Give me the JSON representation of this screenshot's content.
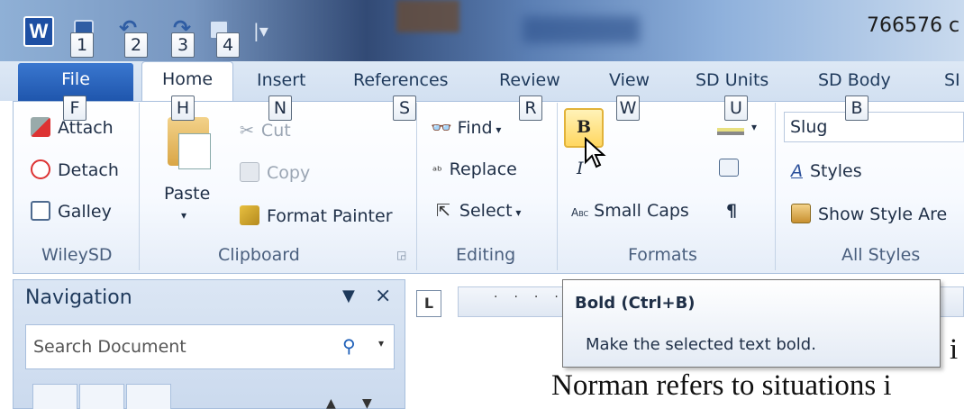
{
  "window": {
    "title": "766576 c"
  },
  "tabs": [
    {
      "label": "File"
    },
    {
      "label": "Home"
    },
    {
      "label": "Insert"
    },
    {
      "label": "References"
    },
    {
      "label": "Review"
    },
    {
      "label": "View"
    },
    {
      "label": "SD Units"
    },
    {
      "label": "SD Body"
    },
    {
      "label": "SI"
    }
  ],
  "keytips": [
    "1",
    "2",
    "3",
    "4",
    "F",
    "H",
    "N",
    "S",
    "R",
    "W",
    "U",
    "B"
  ],
  "ribbon": {
    "wileysd": {
      "attach": "Attach",
      "detach": "Detach",
      "galley": "Galley",
      "label": "WileySD"
    },
    "clipboard": {
      "paste": "Paste",
      "cut": "Cut",
      "copy": "Copy",
      "format_painter": "Format Painter",
      "label": "Clipboard"
    },
    "editing": {
      "find": "Find",
      "replace": "Replace",
      "select": "Select",
      "label": "Editing"
    },
    "formats": {
      "bold_glyph": "B",
      "italic_glyph": "I",
      "small_caps_prefix": "Abc",
      "small_caps": "Small Caps",
      "pilcrow": "¶",
      "label": "Formats"
    },
    "all_styles": {
      "style_value": "Slug",
      "styles": "Styles",
      "show_style_area": "Show Style Are",
      "label": "All Styles"
    }
  },
  "navigation": {
    "title": "Navigation",
    "search_placeholder": "Search Document"
  },
  "ruler": {
    "corner": "L"
  },
  "tooltip": {
    "title": "Bold (Ctrl+B)",
    "description": "Make the selected text bold."
  },
  "document": {
    "line": "Norman refers to situations i",
    "fragment": "i"
  }
}
